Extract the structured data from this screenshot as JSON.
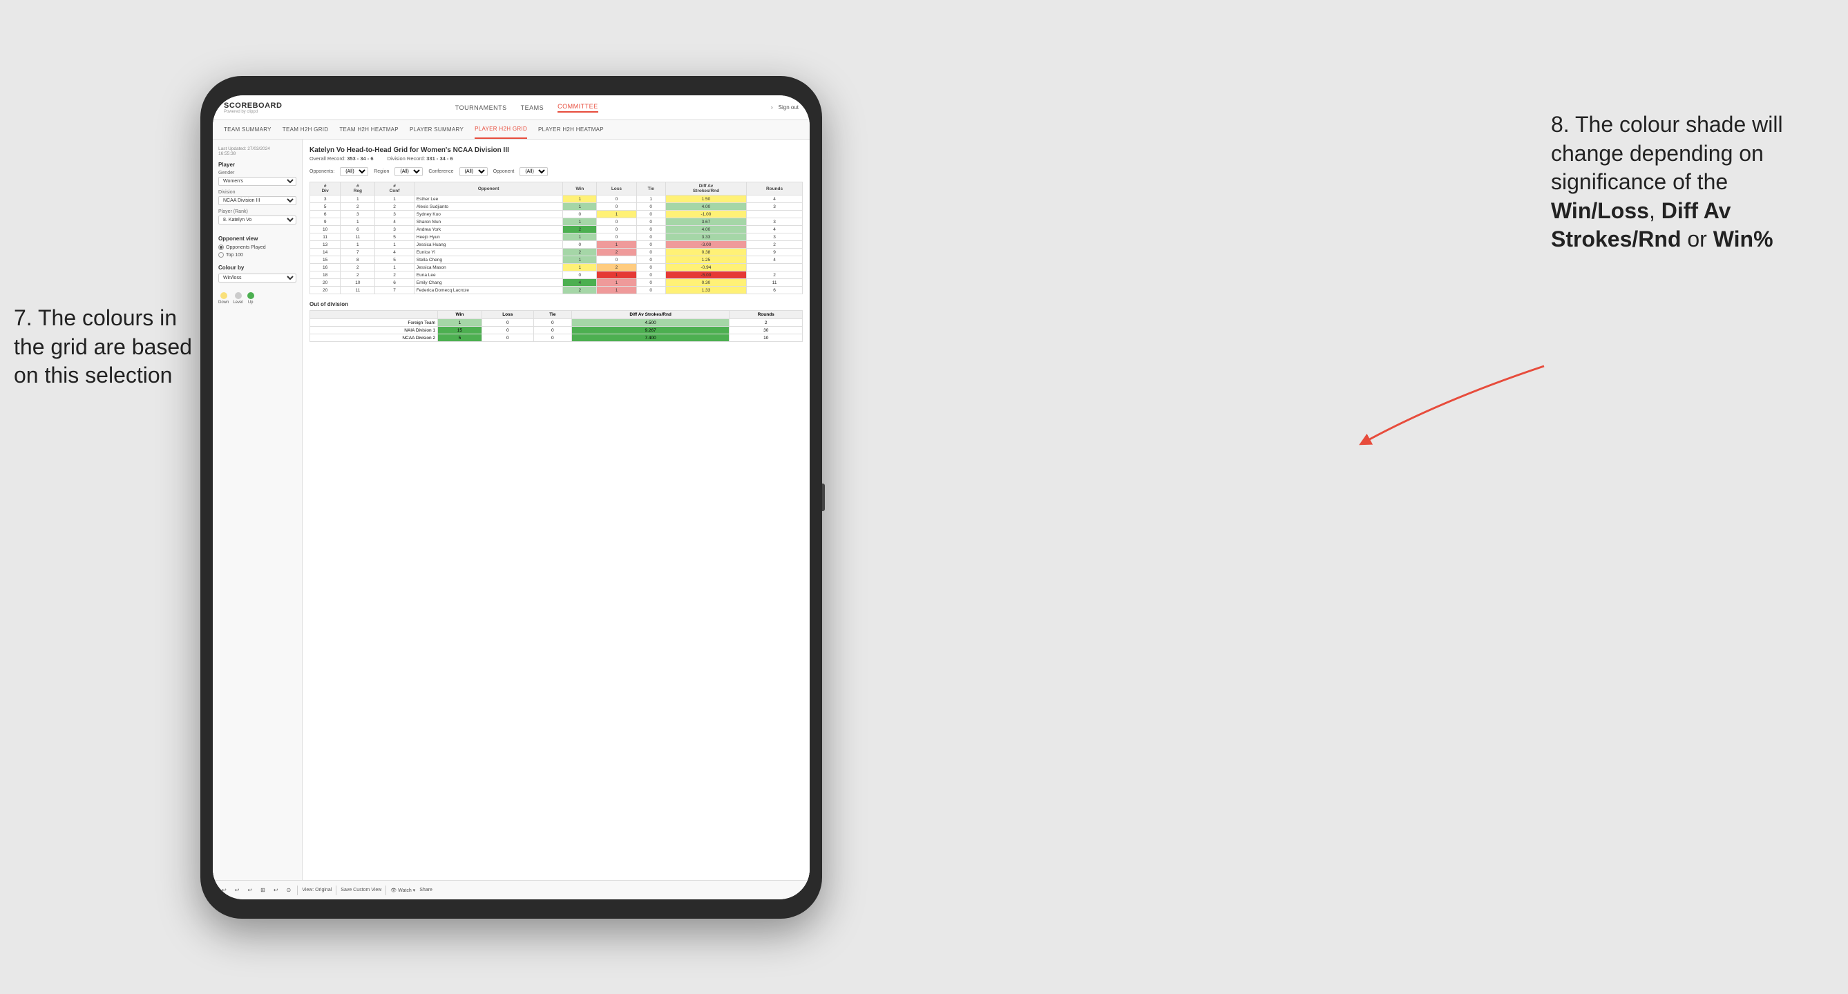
{
  "app": {
    "logo": "SCOREBOARD",
    "logo_sub": "Powered by clippd",
    "nav": [
      "TOURNAMENTS",
      "TEAMS",
      "COMMITTEE"
    ],
    "active_nav": "COMMITTEE",
    "sign_in_icon": "›",
    "sign_out": "Sign out"
  },
  "sub_nav": [
    "TEAM SUMMARY",
    "TEAM H2H GRID",
    "TEAM H2H HEATMAP",
    "PLAYER SUMMARY",
    "PLAYER H2H GRID",
    "PLAYER H2H HEATMAP"
  ],
  "active_sub_nav": "PLAYER H2H GRID",
  "sidebar": {
    "timestamp_label": "Last Updated: 27/03/2024",
    "timestamp_time": "16:55:38",
    "player_section": "Player",
    "gender_label": "Gender",
    "gender_value": "Women's",
    "division_label": "Division",
    "division_value": "NCAA Division III",
    "player_rank_label": "Player (Rank)",
    "player_rank_value": "8. Katelyn Vo",
    "opponent_view_label": "Opponent view",
    "opponent_played": "Opponents Played",
    "top_100": "Top 100",
    "colour_by_label": "Colour by",
    "colour_by_value": "Win/loss",
    "legend_down": "Down",
    "legend_level": "Level",
    "legend_up": "Up"
  },
  "grid": {
    "title": "Katelyn Vo Head-to-Head Grid for Women's NCAA Division III",
    "overall_record_label": "Overall Record:",
    "overall_record": "353 - 34 - 6",
    "division_record_label": "Division Record:",
    "division_record": "331 - 34 - 6",
    "opponents_label": "Opponents:",
    "opponents_value": "(All)",
    "region_label": "Region",
    "region_value": "(All)",
    "conference_label": "Conference",
    "conference_value": "(All)",
    "opponent_label": "Opponent",
    "opponent_value": "(All)",
    "col_headers": [
      "#\nDiv",
      "#\nReg",
      "#\nConf",
      "Opponent",
      "Win",
      "Loss",
      "Tie",
      "Diff Av\nStrokes/Rnd",
      "Rounds"
    ],
    "rows": [
      {
        "div": "3",
        "reg": "1",
        "conf": "1",
        "opponent": "Esther Lee",
        "win": "1",
        "loss": "0",
        "tie": "1",
        "diff": "1.50",
        "rounds": "4",
        "win_color": "yellow",
        "loss_color": "",
        "diff_color": "yellow"
      },
      {
        "div": "5",
        "reg": "2",
        "conf": "2",
        "opponent": "Alexis Sudjianto",
        "win": "1",
        "loss": "0",
        "tie": "0",
        "diff": "4.00",
        "rounds": "3",
        "win_color": "green-light",
        "loss_color": "",
        "diff_color": "green-light"
      },
      {
        "div": "6",
        "reg": "3",
        "conf": "3",
        "opponent": "Sydney Kuo",
        "win": "0",
        "loss": "1",
        "tie": "0",
        "diff": "-1.00",
        "rounds": "",
        "win_color": "",
        "loss_color": "yellow",
        "diff_color": "yellow"
      },
      {
        "div": "9",
        "reg": "1",
        "conf": "4",
        "opponent": "Sharon Mun",
        "win": "1",
        "loss": "0",
        "tie": "0",
        "diff": "3.67",
        "rounds": "3",
        "win_color": "green-light",
        "loss_color": "",
        "diff_color": "green-light"
      },
      {
        "div": "10",
        "reg": "6",
        "conf": "3",
        "opponent": "Andrea York",
        "win": "2",
        "loss": "0",
        "tie": "0",
        "diff": "4.00",
        "rounds": "4",
        "win_color": "green-dark",
        "loss_color": "",
        "diff_color": "green-light"
      },
      {
        "div": "11",
        "reg": "11",
        "conf": "5",
        "opponent": "Heejo Hyun",
        "win": "1",
        "loss": "0",
        "tie": "0",
        "diff": "3.33",
        "rounds": "3",
        "win_color": "green-light",
        "loss_color": "",
        "diff_color": "green-light"
      },
      {
        "div": "13",
        "reg": "1",
        "conf": "1",
        "opponent": "Jessica Huang",
        "win": "0",
        "loss": "1",
        "tie": "0",
        "diff": "-3.00",
        "rounds": "2",
        "win_color": "",
        "loss_color": "red-light",
        "diff_color": "red-light"
      },
      {
        "div": "14",
        "reg": "7",
        "conf": "4",
        "opponent": "Eunice Yi",
        "win": "2",
        "loss": "2",
        "tie": "0",
        "diff": "0.38",
        "rounds": "9",
        "win_color": "green-light",
        "loss_color": "red-light",
        "diff_color": "yellow"
      },
      {
        "div": "15",
        "reg": "8",
        "conf": "5",
        "opponent": "Stella Cheng",
        "win": "1",
        "loss": "0",
        "tie": "0",
        "diff": "1.25",
        "rounds": "4",
        "win_color": "green-light",
        "loss_color": "",
        "diff_color": "yellow"
      },
      {
        "div": "16",
        "reg": "2",
        "conf": "1",
        "opponent": "Jessica Mason",
        "win": "1",
        "loss": "2",
        "tie": "0",
        "diff": "-0.94",
        "rounds": "",
        "win_color": "yellow",
        "loss_color": "orange",
        "diff_color": "yellow"
      },
      {
        "div": "18",
        "reg": "2",
        "conf": "2",
        "opponent": "Euna Lee",
        "win": "0",
        "loss": "1",
        "tie": "0",
        "diff": "-5.00",
        "rounds": "2",
        "win_color": "",
        "loss_color": "red-dark",
        "diff_color": "red-dark"
      },
      {
        "div": "20",
        "reg": "10",
        "conf": "6",
        "opponent": "Emily Chang",
        "win": "4",
        "loss": "1",
        "tie": "0",
        "diff": "0.30",
        "rounds": "11",
        "win_color": "green-dark",
        "loss_color": "red-light",
        "diff_color": "yellow"
      },
      {
        "div": "20",
        "reg": "11",
        "conf": "7",
        "opponent": "Federica Domecq Lacroze",
        "win": "2",
        "loss": "1",
        "tie": "0",
        "diff": "1.33",
        "rounds": "6",
        "win_color": "green-light",
        "loss_color": "red-light",
        "diff_color": "yellow"
      }
    ],
    "out_of_division_title": "Out of division",
    "out_rows": [
      {
        "team": "Foreign Team",
        "win": "1",
        "loss": "0",
        "tie": "0",
        "diff": "4.500",
        "rounds": "2",
        "win_color": "green-light"
      },
      {
        "team": "NAIA Division 1",
        "win": "15",
        "loss": "0",
        "tie": "0",
        "diff": "9.267",
        "rounds": "30",
        "win_color": "green-dark"
      },
      {
        "team": "NCAA Division 2",
        "win": "5",
        "loss": "0",
        "tie": "0",
        "diff": "7.400",
        "rounds": "10",
        "win_color": "green-dark"
      }
    ]
  },
  "toolbar": {
    "undo": "↩",
    "redo": "↪",
    "view_original": "View: Original",
    "save_custom": "Save Custom View",
    "watch": "Watch",
    "share": "Share"
  },
  "annotations": {
    "left_text": "7. The colours in the grid are based on this selection",
    "right_text_prefix": "8. The colour shade will change depending on significance of the ",
    "right_bold1": "Win/Loss",
    "right_comma": ", ",
    "right_bold2": "Diff Av Strokes/Rnd",
    "right_or": " or ",
    "right_bold3": "Win%"
  }
}
